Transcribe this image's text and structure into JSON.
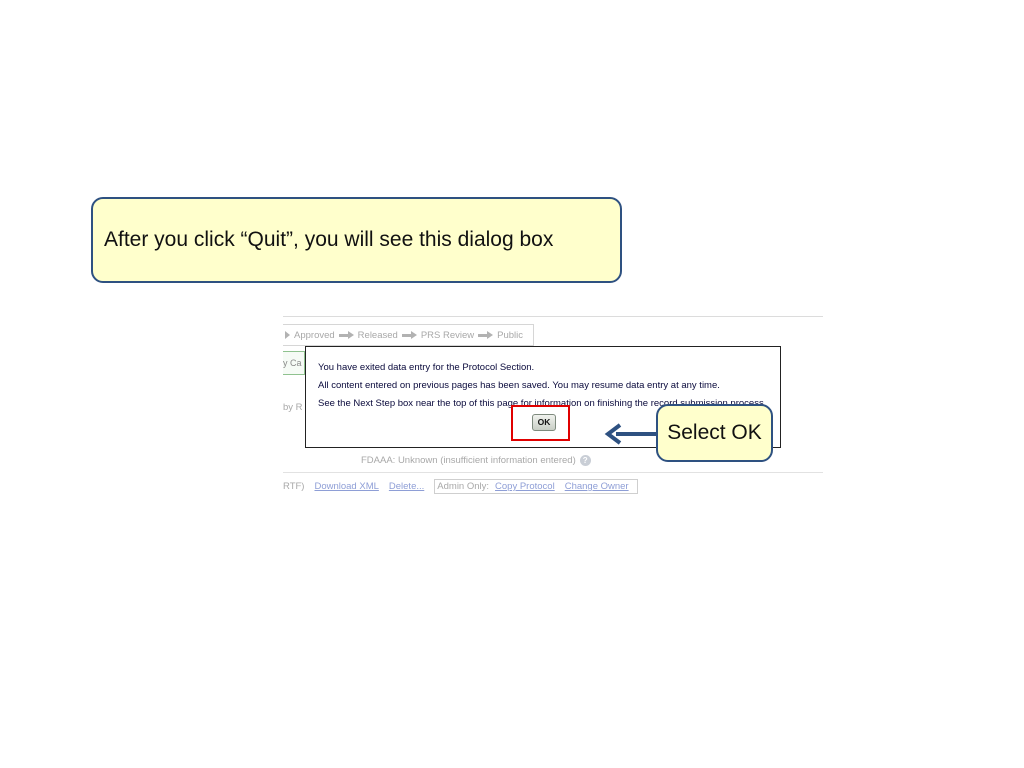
{
  "callouts": {
    "top": "After you click “Quit”, you will see this dialog box",
    "ok": "Select OK"
  },
  "workflow": {
    "steps": [
      "Approved",
      "Released",
      "PRS Review",
      "Public"
    ]
  },
  "fragments": {
    "left_button": "y Ca",
    "left_text": "by R"
  },
  "dialog": {
    "message_1": "You have exited data entry for the Protocol Section.",
    "message_2": "All content entered on previous pages has been saved. You may resume data entry at any time.",
    "message_3": "See the Next Step box near the top of this page for information on finishing the record submission process.",
    "ok_label": "OK"
  },
  "status": {
    "fdaaa": "FDAAA:  Unknown (insufficient information entered)",
    "help_icon": "question-icon"
  },
  "links": {
    "rtf_fragment": "RTF)",
    "download_xml": "Download XML",
    "delete": "Delete...",
    "admin_label": "Admin Only:",
    "copy_protocol": "Copy Protocol",
    "change_owner": "Change Owner"
  },
  "colors": {
    "callout_fill": "#ffffcc",
    "callout_border": "#2e5181",
    "highlight": "#e00000",
    "link": "#8e9ed6"
  }
}
